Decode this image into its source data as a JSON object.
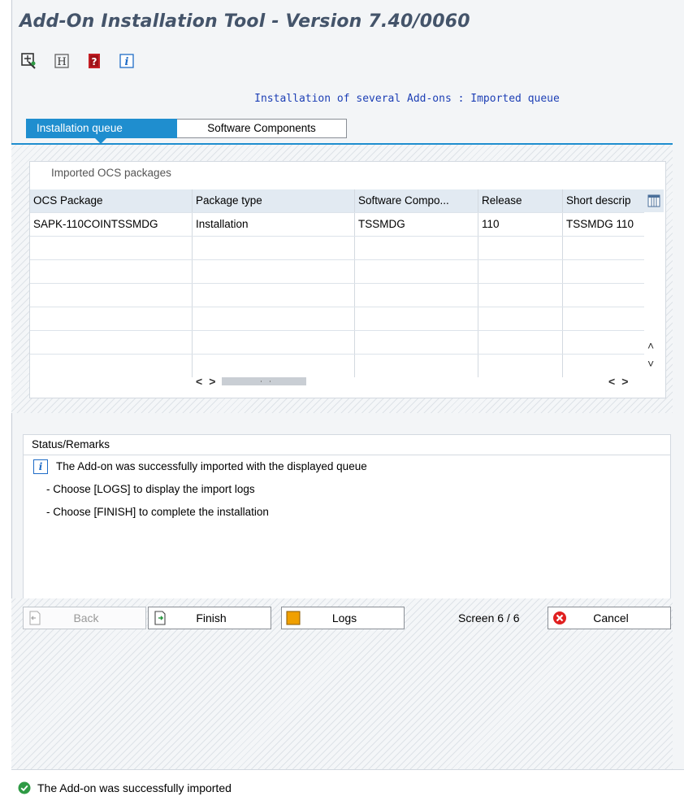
{
  "window": {
    "title": "Add-On Installation Tool - Version 7.40/0060"
  },
  "toolbar": {
    "icons": [
      "navigation-icon",
      "h-letter-icon",
      "help-book-icon",
      "info-icon"
    ]
  },
  "main": {
    "heading": "Installation of several Add-ons : Imported queue",
    "tabs": [
      {
        "label": "Installation queue",
        "active": true
      },
      {
        "label": "Software Components",
        "active": false
      }
    ]
  },
  "packages": {
    "group_title": "Imported OCS packages",
    "columns": [
      "OCS Package",
      "Package type",
      "Software Compo...",
      "Release",
      "Short descrip"
    ],
    "rows": [
      [
        "SAPK-110COINTSSMDG",
        "Installation",
        "TSSMDG",
        "110",
        "TSSMDG 110"
      ]
    ]
  },
  "status": {
    "title": "Status/Remarks",
    "lines": [
      "The Add-on was successfully imported with the displayed queue",
      "- Choose [LOGS] to display the import logs",
      "- Choose [FINISH] to complete the installation"
    ]
  },
  "buttons": {
    "back": "Back",
    "finish": "Finish",
    "logs": "Logs",
    "screen": "Screen 6 / 6",
    "cancel": "Cancel"
  },
  "statusbar": {
    "message": "The Add-on was successfully imported"
  },
  "colors": {
    "accent": "#1f8ecf",
    "heading_text": "#1d3fb5",
    "title_text": "#44546a",
    "cancel_red": "#e02020",
    "success_green": "#2e9a44",
    "logs_orange": "#f0a000"
  }
}
